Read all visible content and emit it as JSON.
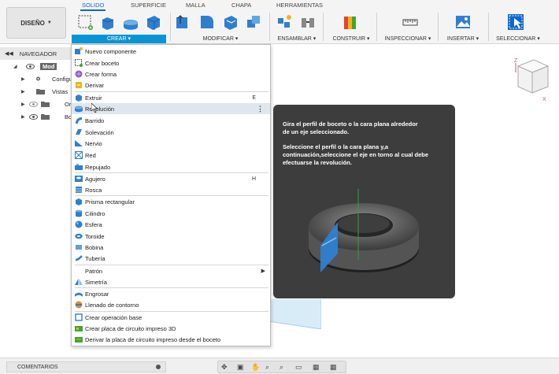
{
  "toolbar": {
    "design_label": "DISEÑO",
    "tabs": [
      "SOLIDO",
      "SUPERFICIE",
      "MALLA",
      "CHAPA",
      "HERRAMIENTAS"
    ],
    "groups": [
      "CREAR",
      "MODIFICAR",
      "ENSAMBLAR",
      "CONSTRUIR",
      "INSPECCIONAR",
      "INSERTAR",
      "SELECCIONAR"
    ],
    "accent_color": "#0696d7"
  },
  "navigator": {
    "title": "NAVEGADOR",
    "items": [
      {
        "label": "Mod"
      },
      {
        "label": "Configu"
      },
      {
        "label": "Vistas"
      },
      {
        "label": "Ori"
      },
      {
        "label": "Bo"
      }
    ]
  },
  "menu": {
    "items": [
      {
        "label": "Nuevo componente",
        "icon": "new-component-icon"
      },
      {
        "label": "Crear boceto",
        "icon": "sketch-icon"
      },
      {
        "label": "Crear forma",
        "icon": "form-icon"
      },
      {
        "label": "Derivar",
        "icon": "derive-icon"
      },
      {
        "label": "Extruir",
        "icon": "extrude-icon",
        "shortcut": "E"
      },
      {
        "label": "Revolución",
        "icon": "revolve-icon",
        "highlighted": true
      },
      {
        "label": "Barrido",
        "icon": "sweep-icon"
      },
      {
        "label": "Solevación",
        "icon": "loft-icon"
      },
      {
        "label": "Nervio",
        "icon": "rib-icon"
      },
      {
        "label": "Red",
        "icon": "web-icon"
      },
      {
        "label": "Repujado",
        "icon": "emboss-icon"
      },
      {
        "label": "Agujero",
        "icon": "hole-icon",
        "shortcut": "H"
      },
      {
        "label": "Rosca",
        "icon": "thread-icon"
      },
      {
        "label": "Prisma rectangular",
        "icon": "box-icon"
      },
      {
        "label": "Cilindro",
        "icon": "cylinder-icon"
      },
      {
        "label": "Esfera",
        "icon": "sphere-icon"
      },
      {
        "label": "Toroide",
        "icon": "torus-icon"
      },
      {
        "label": "Bobina",
        "icon": "coil-icon"
      },
      {
        "label": "Tubería",
        "icon": "pipe-icon"
      },
      {
        "label": "Patrón",
        "icon": "",
        "submenu": true
      },
      {
        "label": "Simetría",
        "icon": "mirror-icon"
      },
      {
        "label": "Engrosar",
        "icon": "thicken-icon"
      },
      {
        "label": "Llenado de contorno",
        "icon": "boundary-fill-icon"
      },
      {
        "label": "Crear operación base",
        "icon": "base-feature-icon"
      },
      {
        "label": "Crear placa de circuito impreso 3D",
        "icon": "pcb-icon"
      },
      {
        "label": "Derivar la placa de circuito impreso desde el boceto",
        "icon": "pcb-sketch-icon"
      }
    ]
  },
  "tooltip": {
    "line1": "Gira el perfil de boceto o la cara plana alrededor de un eje seleccionado.",
    "line2": "Seleccione el perfil o la cara plana y,a continuación,seleccione el eje en torno al cual debe efectuarse la revolución."
  },
  "viewcube": {
    "z_label": "Z",
    "x_label": "X"
  },
  "bottom": {
    "comments_label": "COMENTARIOS"
  }
}
